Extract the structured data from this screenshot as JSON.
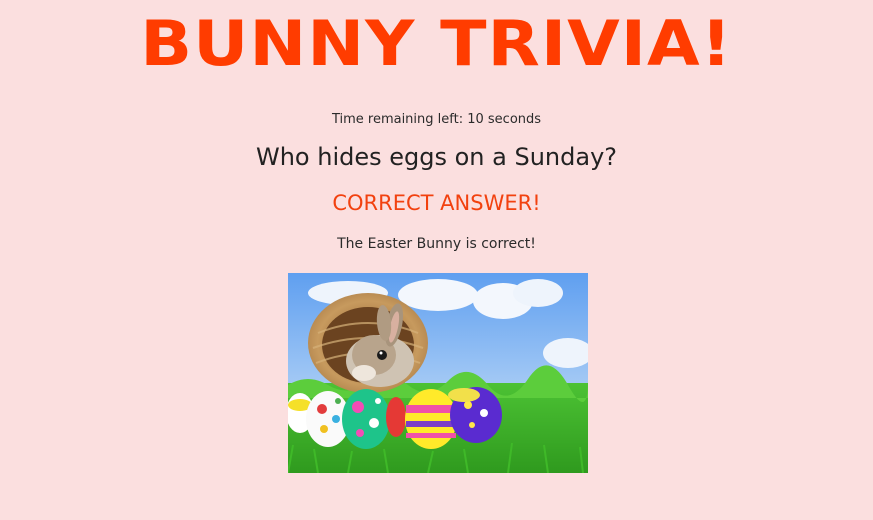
{
  "header": {
    "title": "Bunny Trivia!"
  },
  "timer": {
    "text": "Time remaining left: 10 seconds"
  },
  "question": {
    "text": "Who hides eggs on a Sunday?"
  },
  "result": {
    "text": "CORRECT ANSWER!",
    "color": "#f2410f"
  },
  "explanation": {
    "text": "The Easter Bunny is correct!"
  },
  "image": {
    "subject": "bunny-in-basket-with-easter-eggs"
  },
  "colors": {
    "background": "#fbdfdf",
    "title": "#ff3c00"
  }
}
